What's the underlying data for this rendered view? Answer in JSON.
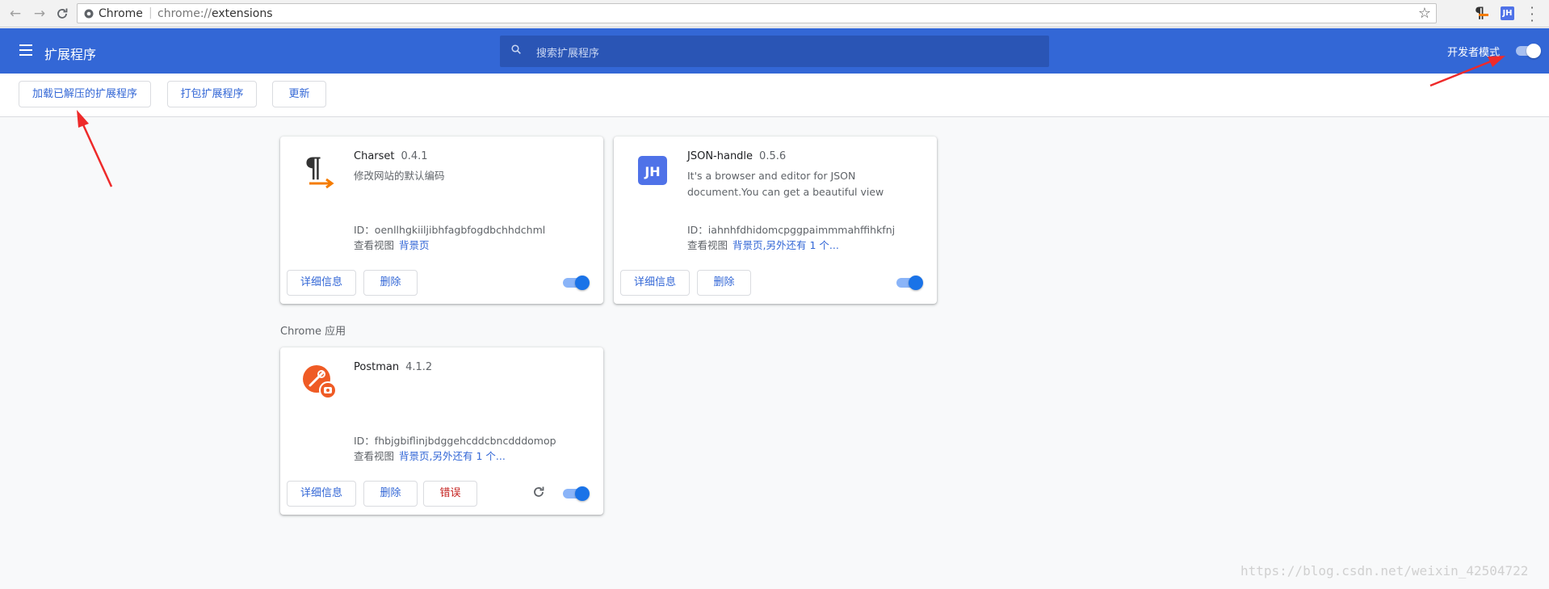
{
  "browser": {
    "scheme_label": "Chrome",
    "url_scheme": "chrome://",
    "url_path": "extensions",
    "toolbar_icons": [
      "back-icon",
      "forward-icon",
      "reload-icon",
      "star-icon",
      "charset-extension-icon",
      "jsonhandle-extension-icon",
      "menu-icon"
    ],
    "jh_badge": "JH"
  },
  "header": {
    "title": "扩展程序",
    "search_placeholder": "搜索扩展程序",
    "developer_mode_label": "开发者模式",
    "developer_mode_on": true
  },
  "toolbar": {
    "load_unpacked": "加载已解压的扩展程序",
    "pack": "打包扩展程序",
    "update": "更新"
  },
  "extensions": [
    {
      "name": "Charset",
      "version": "0.4.1",
      "description": "修改网站的默认编码",
      "id_text": "ID：oenllhgkiiljibhfagbfogdbchhdchml",
      "views_label": "查看视图",
      "views_links": "背景页",
      "details_btn": "详细信息",
      "remove_btn": "删除",
      "enabled": true
    },
    {
      "name": "JSON-handle",
      "version": "0.5.6",
      "description": "It's a browser and editor for JSON document.You can get a beautiful view",
      "id_text": "ID：iahnhfdhidomcpggpaimmmahffihkfnj",
      "views_label": "查看视图",
      "views_links": "背景页,另外还有 1 个...",
      "details_btn": "详细信息",
      "remove_btn": "删除",
      "enabled": true,
      "icon_text": "JH"
    }
  ],
  "apps_section": {
    "label": "Chrome 应用",
    "apps": [
      {
        "name": "Postman",
        "version": "4.1.2",
        "id_text": "ID：fhbjgbiflinjbdggehcddcbncdddomop",
        "views_label": "查看视图",
        "views_links": "背景页,另外还有 1 个...",
        "details_btn": "详细信息",
        "remove_btn": "删除",
        "errors_btn": "错误",
        "enabled": true
      }
    ]
  },
  "watermark": "https://blog.csdn.net/weixin_42504722",
  "colors": {
    "header_blue": "#3367d6",
    "search_bg": "#2a55b5",
    "link_blue": "#3367d6",
    "toggle_knob": "#1a73e8",
    "error_red": "#c5221f",
    "arrow_red": "#ee2a2a",
    "charset_orange": "#f57c00",
    "jh_blue": "#4f72e8",
    "postman_orange": "#ef5b25"
  }
}
